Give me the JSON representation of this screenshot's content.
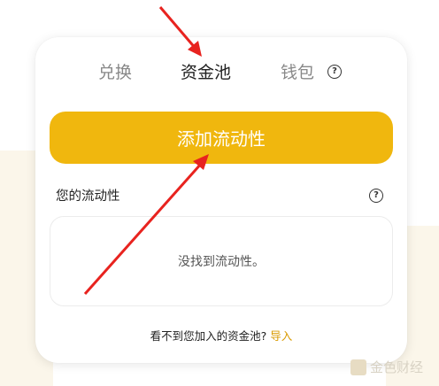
{
  "tabs": [
    {
      "label": "兑换",
      "active": false
    },
    {
      "label": "资金池",
      "active": true
    },
    {
      "label": "钱包",
      "active": false
    }
  ],
  "help_icon_glyph": "?",
  "add_liquidity_label": "添加流动性",
  "liquidity": {
    "title": "您的流动性",
    "empty_text": "没找到流动性。"
  },
  "footer": {
    "prompt": "看不到您加入的资金池?",
    "import_label": "导入"
  },
  "watermark": "金色财经",
  "colors": {
    "accent": "#f0b70e",
    "link": "#d99a00",
    "annotation_arrow": "#e8231f"
  }
}
